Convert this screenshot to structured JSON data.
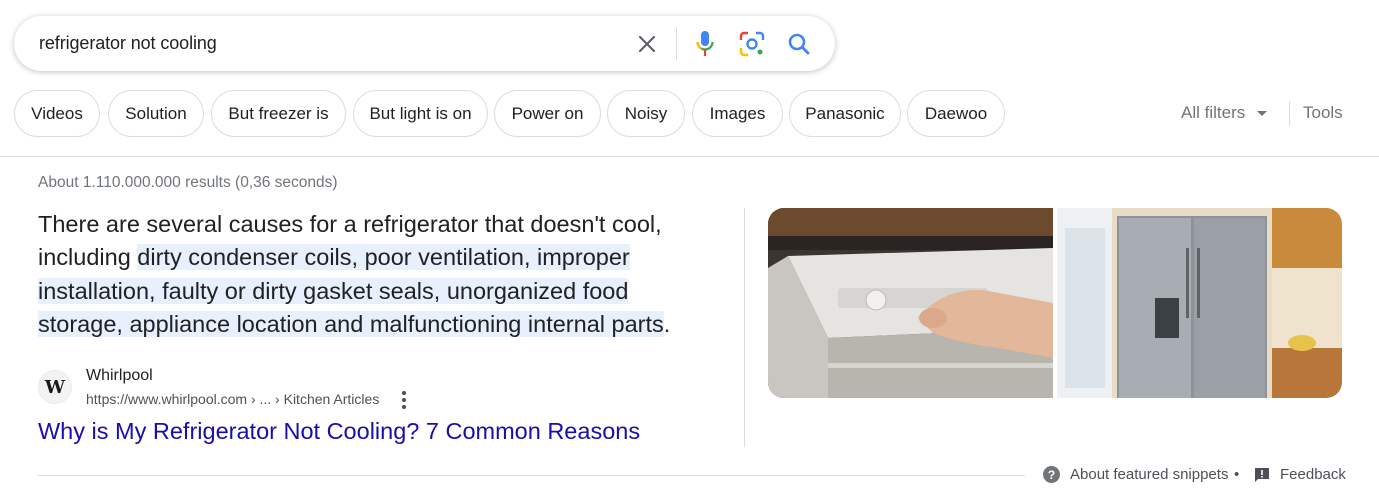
{
  "search": {
    "query": "refrigerator not cooling",
    "icons": [
      "close-icon",
      "microphone-icon",
      "lens-icon",
      "search-icon"
    ]
  },
  "chips": [
    "Videos",
    "Solution",
    "But freezer is",
    "But light is on",
    "Power on",
    "Noisy",
    "Images",
    "Panasonic",
    "Daewoo"
  ],
  "filters": {
    "all_filters": "All filters",
    "tools": "Tools"
  },
  "stats": "About 1.110.000.000 results (0,36 seconds)",
  "snippet": {
    "text_plain": "There are several causes for a refrigerator that doesn't cool, including ",
    "text_highlight": "dirty condenser coils, poor ventilation, improper installation, faulty or dirty gasket seals, unorganized food storage, appliance location and malfunctioning internal parts",
    "text_end": "."
  },
  "source": {
    "favicon_letter": "W",
    "name": "Whirlpool",
    "url": "https://www.whirlpool.com › ... › Kitchen Articles",
    "title": "Why is My Refrigerator Not Cooling? 7 Common Reasons"
  },
  "footer": {
    "about": "About featured snippets",
    "separator": "•",
    "feedback": "Feedback"
  },
  "colors": {
    "link": "#1a0dab",
    "highlight": "#e8f0fe",
    "secondary_text": "#70757a"
  }
}
